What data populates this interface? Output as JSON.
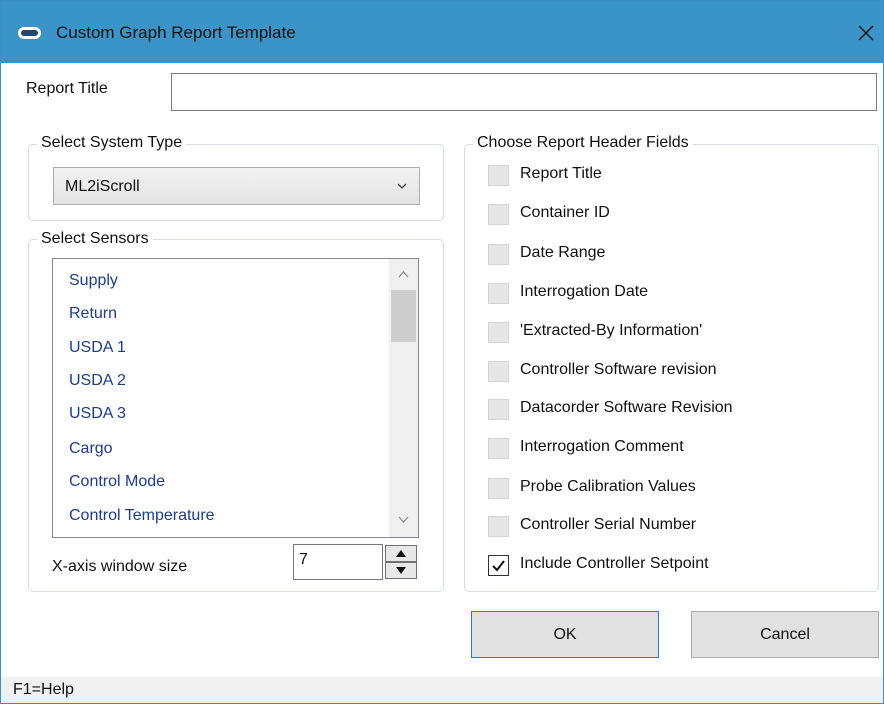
{
  "window": {
    "title": "Custom Graph Report Template",
    "close_glyph": "✕"
  },
  "report_title": {
    "label": "Report Title",
    "value": "",
    "placeholder": ""
  },
  "system_type": {
    "group_title": "Select System Type",
    "selected": "ML2iScroll"
  },
  "sensors": {
    "group_title": "Select Sensors",
    "items": [
      "Supply",
      "Return",
      "USDA 1",
      "USDA 2",
      "USDA 3",
      "Cargo",
      "Control Mode",
      "Control Temperature"
    ],
    "xaxis_label": "X-axis window size",
    "xaxis_value": "7"
  },
  "header_fields": {
    "group_title": "Choose Report Header Fields",
    "items": [
      {
        "label": "Report Title",
        "checked": false
      },
      {
        "label": "Container ID",
        "checked": false
      },
      {
        "label": "Date Range",
        "checked": false
      },
      {
        "label": "Interrogation Date",
        "checked": false
      },
      {
        "label": "'Extracted-By Information'",
        "checked": false
      },
      {
        "label": "Controller Software revision",
        "checked": false
      },
      {
        "label": "Datacorder Software Revision",
        "checked": false
      },
      {
        "label": "Interrogation Comment",
        "checked": false
      },
      {
        "label": "Probe Calibration Values",
        "checked": false
      },
      {
        "label": "Controller Serial Number",
        "checked": false
      },
      {
        "label": "Include Controller Setpoint",
        "checked": true
      }
    ]
  },
  "buttons": {
    "ok": "OK",
    "cancel": "Cancel"
  },
  "status_bar": {
    "text": "F1=Help"
  },
  "colors": {
    "titlebar": "#3a94c7",
    "link_text": "#1f3c88",
    "default_button_border": "#2b79d6"
  }
}
